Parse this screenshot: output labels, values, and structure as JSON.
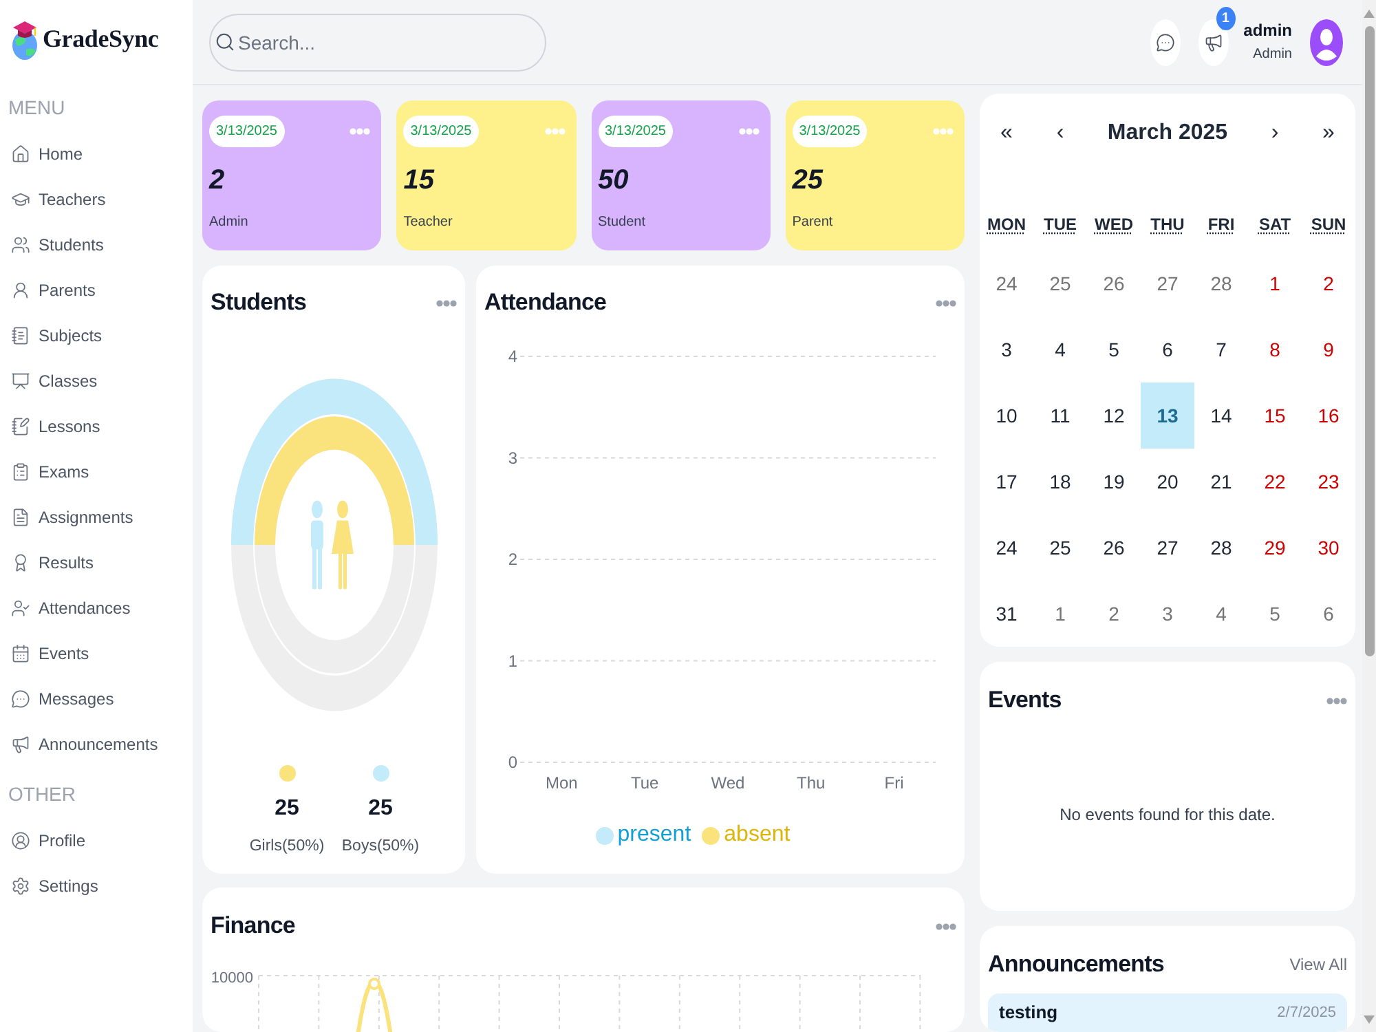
{
  "sidebar": {
    "logo_text": "GradeSync",
    "sections": [
      {
        "title": "MENU",
        "items": [
          {
            "label": "Home"
          },
          {
            "label": "Teachers"
          },
          {
            "label": "Students"
          },
          {
            "label": "Parents"
          },
          {
            "label": "Subjects"
          },
          {
            "label": "Classes"
          },
          {
            "label": "Lessons"
          },
          {
            "label": "Exams"
          },
          {
            "label": "Assignments"
          },
          {
            "label": "Results"
          },
          {
            "label": "Attendances"
          },
          {
            "label": "Events"
          },
          {
            "label": "Messages"
          },
          {
            "label": "Announcements"
          }
        ]
      },
      {
        "title": "OTHER",
        "items": [
          {
            "label": "Profile"
          },
          {
            "label": "Settings"
          }
        ]
      }
    ]
  },
  "topbar": {
    "search": {
      "placeholder": "Search..."
    },
    "notification_badge": "1",
    "user": {
      "name": "admin",
      "role": "Admin"
    }
  },
  "stat_cards": [
    {
      "date": "3/13/2025",
      "count": "2",
      "label": "Admin",
      "color": "#d8b4fe"
    },
    {
      "date": "3/13/2025",
      "count": "15",
      "label": "Teacher",
      "color": "#fef08a"
    },
    {
      "date": "3/13/2025",
      "count": "50",
      "label": "Student",
      "color": "#d8b4fe"
    },
    {
      "date": "3/13/2025",
      "count": "25",
      "label": "Parent",
      "color": "#fef08a"
    }
  ],
  "students": {
    "title": "Students",
    "groups": [
      {
        "count": "25",
        "label": "Girls(50%)",
        "color": "#fae27c",
        "level": 0.5
      },
      {
        "count": "25",
        "label": "Boys(50%)",
        "color": "#c3ebfa",
        "level": 0.5
      }
    ]
  },
  "attendance": {
    "title": "Attendance",
    "chart_data": {
      "type": "bar",
      "categories": [
        "Mon",
        "Tue",
        "Wed",
        "Thu",
        "Fri"
      ],
      "series": [
        {
          "name": "present",
          "color": "#c3ebfa",
          "values": [
            0,
            0,
            0,
            0,
            0
          ]
        },
        {
          "name": "absent",
          "color": "#fae27c",
          "values": [
            0,
            0,
            0,
            0,
            0
          ]
        }
      ],
      "ylim": [
        0,
        4
      ],
      "yticks": [
        0,
        1,
        2,
        3,
        4
      ],
      "grid": true
    }
  },
  "finance": {
    "title": "Finance",
    "y_tick": "10000"
  },
  "calendar": {
    "title": "March 2025",
    "nav": [
      "«",
      "‹",
      "›",
      "»"
    ],
    "weekdays": [
      "MON",
      "TUE",
      "WED",
      "THU",
      "FRI",
      "SAT",
      "SUN"
    ],
    "days": [
      {
        "label": "24",
        "kind": "other_month",
        "selected": false
      },
      {
        "label": "25",
        "kind": "other_month",
        "selected": false
      },
      {
        "label": "26",
        "kind": "other_month",
        "selected": false
      },
      {
        "label": "27",
        "kind": "other_month",
        "selected": false
      },
      {
        "label": "28",
        "kind": "other_month",
        "selected": false
      },
      {
        "label": "1",
        "kind": "weekend",
        "selected": false
      },
      {
        "label": "2",
        "kind": "weekend",
        "selected": false
      },
      {
        "label": "3",
        "kind": "weekday",
        "selected": false
      },
      {
        "label": "4",
        "kind": "weekday",
        "selected": false
      },
      {
        "label": "5",
        "kind": "weekday",
        "selected": false
      },
      {
        "label": "6",
        "kind": "weekday",
        "selected": false
      },
      {
        "label": "7",
        "kind": "weekday",
        "selected": false
      },
      {
        "label": "8",
        "kind": "weekend",
        "selected": false
      },
      {
        "label": "9",
        "kind": "weekend",
        "selected": false
      },
      {
        "label": "10",
        "kind": "weekday",
        "selected": false
      },
      {
        "label": "11",
        "kind": "weekday",
        "selected": false
      },
      {
        "label": "12",
        "kind": "weekday",
        "selected": false
      },
      {
        "label": "13",
        "kind": "weekday",
        "selected": true
      },
      {
        "label": "14",
        "kind": "weekday",
        "selected": false
      },
      {
        "label": "15",
        "kind": "weekend",
        "selected": false
      },
      {
        "label": "16",
        "kind": "weekend",
        "selected": false
      },
      {
        "label": "17",
        "kind": "weekday",
        "selected": false
      },
      {
        "label": "18",
        "kind": "weekday",
        "selected": false
      },
      {
        "label": "19",
        "kind": "weekday",
        "selected": false
      },
      {
        "label": "20",
        "kind": "weekday",
        "selected": false
      },
      {
        "label": "21",
        "kind": "weekday",
        "selected": false
      },
      {
        "label": "22",
        "kind": "weekend",
        "selected": false
      },
      {
        "label": "23",
        "kind": "weekend",
        "selected": false
      },
      {
        "label": "24",
        "kind": "weekday",
        "selected": false
      },
      {
        "label": "25",
        "kind": "weekday",
        "selected": false
      },
      {
        "label": "26",
        "kind": "weekday",
        "selected": false
      },
      {
        "label": "27",
        "kind": "weekday",
        "selected": false
      },
      {
        "label": "28",
        "kind": "weekday",
        "selected": false
      },
      {
        "label": "29",
        "kind": "weekend",
        "selected": false
      },
      {
        "label": "30",
        "kind": "weekend",
        "selected": false
      },
      {
        "label": "31",
        "kind": "weekday",
        "selected": false
      },
      {
        "label": "1",
        "kind": "other_month",
        "selected": false
      },
      {
        "label": "2",
        "kind": "other_month",
        "selected": false
      },
      {
        "label": "3",
        "kind": "other_month",
        "selected": false
      },
      {
        "label": "4",
        "kind": "other_month",
        "selected": false
      },
      {
        "label": "5",
        "kind": "other_month",
        "selected": false
      },
      {
        "label": "6",
        "kind": "other_month",
        "selected": false
      }
    ]
  },
  "events": {
    "title": "Events",
    "empty_message": "No events found for this date."
  },
  "announcements": {
    "title": "Announcements",
    "view_all": "View All",
    "items": [
      {
        "title": "testing",
        "date": "2/7/2025"
      }
    ]
  }
}
